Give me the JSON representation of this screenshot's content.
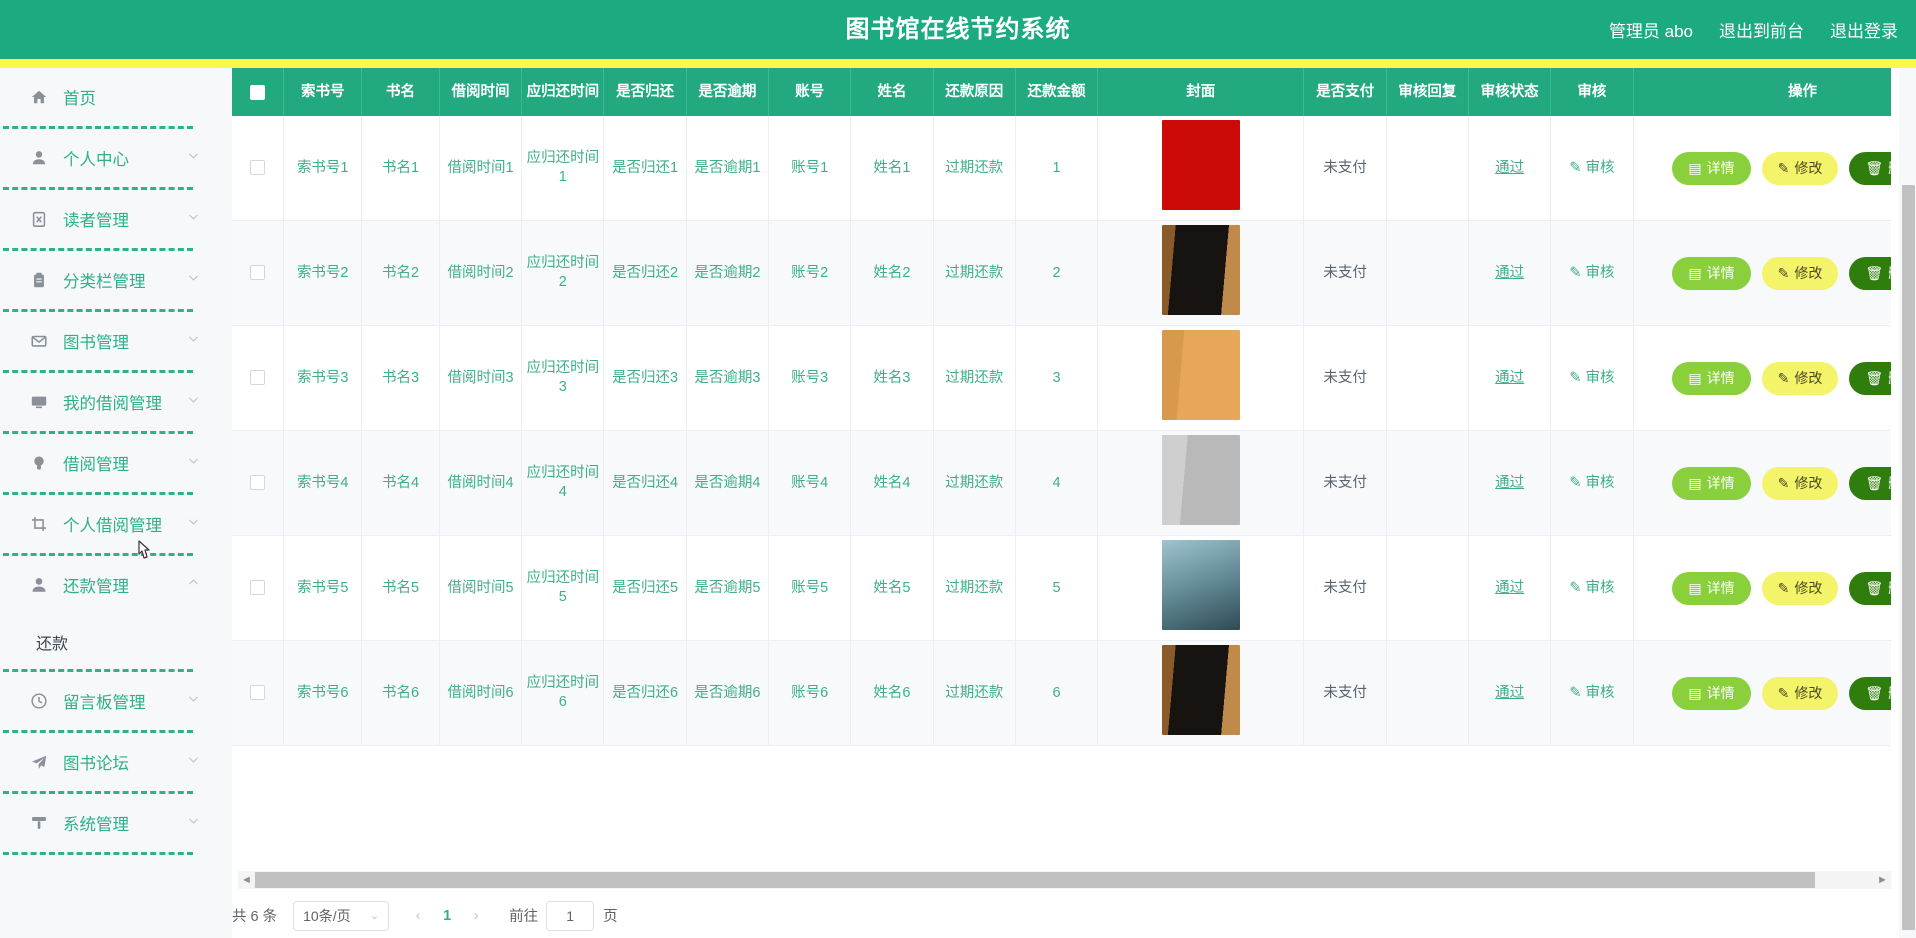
{
  "header": {
    "title": "图书馆在线节约系统",
    "user": "管理员 abo",
    "exit_front": "退出到前台",
    "logout": "退出登录",
    "bg_color": "#1cab81",
    "accent_color": "#faf84b"
  },
  "sidebar": {
    "items": [
      {
        "label": "首页",
        "icon": "home-icon",
        "expandable": false
      },
      {
        "label": "个人中心",
        "icon": "user-icon",
        "expandable": true,
        "expanded": false
      },
      {
        "label": "读者管理",
        "icon": "clipboard-x-icon",
        "expandable": true,
        "expanded": false
      },
      {
        "label": "分类栏管理",
        "icon": "clipboard-icon",
        "expandable": true,
        "expanded": false
      },
      {
        "label": "图书管理",
        "icon": "envelope-icon",
        "expandable": true,
        "expanded": false
      },
      {
        "label": "我的借阅管理",
        "icon": "monitor-icon",
        "expandable": true,
        "expanded": false
      },
      {
        "label": "借阅管理",
        "icon": "bulb-icon",
        "expandable": true,
        "expanded": false
      },
      {
        "label": "个人借阅管理",
        "icon": "crop-icon",
        "expandable": true,
        "expanded": false
      },
      {
        "label": "还款管理",
        "icon": "user-solid-icon",
        "expandable": true,
        "expanded": true
      },
      {
        "label": "留言板管理",
        "icon": "clock-icon",
        "expandable": true,
        "expanded": false
      },
      {
        "label": "图书论坛",
        "icon": "send-icon",
        "expandable": true,
        "expanded": false
      },
      {
        "label": "系统管理",
        "icon": "tool-icon",
        "expandable": true,
        "expanded": false
      }
    ],
    "submenu_of_huankuan": [
      "还款"
    ],
    "label_color": "#2eb088"
  },
  "table": {
    "columns": [
      "",
      "索书号",
      "书名",
      "借阅时间",
      "应归还时间",
      "是否归还",
      "是否逾期",
      "账号",
      "姓名",
      "还款原因",
      "还款金额",
      "封面",
      "是否支付",
      "审核回复",
      "审核状态",
      "审核",
      "操作"
    ],
    "rows": [
      {
        "suoshuhao": "索书号1",
        "shuming": "书名1",
        "jieyue": "借阅时间1",
        "yingguihuan": "应归还时间1",
        "shifouguihuan": "是否归还1",
        "shifouyuqi": "是否逾期1",
        "zhanghao": "账号1",
        "xingming": "姓名1",
        "huankuanyuanyin": "过期还款",
        "huankuanjine": "1",
        "fengmian": "cover-red-monkey",
        "shifouzhifu": "未支付",
        "shenhehuifu": "",
        "shenhezhuangtai": "通过",
        "shenhe": "审核",
        "ops": [
          "详情",
          "修改",
          "删除"
        ]
      },
      {
        "suoshuhao": "索书号2",
        "shuming": "书名2",
        "jieyue": "借阅时间2",
        "yingguihuan": "应归还时间2",
        "shifouguihuan": "是否归还2",
        "shifouyuqi": "是否逾期2",
        "zhanghao": "账号2",
        "xingming": "姓名2",
        "huankuanyuanyin": "过期还款",
        "huankuanjine": "2",
        "fengmian": "cover-black-portrait",
        "shifouzhifu": "未支付",
        "shenhehuifu": "",
        "shenhezhuangtai": "通过",
        "shenhe": "审核",
        "ops": [
          "详情",
          "修改",
          "删除"
        ]
      },
      {
        "suoshuhao": "索书号3",
        "shuming": "书名3",
        "jieyue": "借阅时间3",
        "yingguihuan": "应归还时间3",
        "shifouguihuan": "是否归还3",
        "shifouyuqi": "是否逾期3",
        "zhanghao": "账号3",
        "xingming": "姓名3",
        "huankuanyuanyin": "过期还款",
        "huankuanjine": "3",
        "fengmian": "cover-orange-huainanzi",
        "shifouzhifu": "未支付",
        "shenhehuifu": "",
        "shenhezhuangtai": "通过",
        "shenhe": "审核",
        "ops": [
          "详情",
          "修改",
          "删除"
        ]
      },
      {
        "suoshuhao": "索书号4",
        "shuming": "书名4",
        "jieyue": "借阅时间4",
        "yingguihuan": "应归还时间4",
        "shifouguihuan": "是否归还4",
        "shifouyuqi": "是否逾期4",
        "zhanghao": "账号4",
        "xingming": "姓名4",
        "huankuanyuanyin": "过期还款",
        "huankuanjine": "4",
        "fengmian": "cover-grey-book",
        "shifouzhifu": "未支付",
        "shenhehuifu": "",
        "shenhezhuangtai": "通过",
        "shenhe": "审核",
        "ops": [
          "详情",
          "修改",
          "删除"
        ]
      },
      {
        "suoshuhao": "索书号5",
        "shuming": "书名5",
        "jieyue": "借阅时间5",
        "yingguihuan": "应归还时间5",
        "shifouguihuan": "是否归还5",
        "shifouyuqi": "是否逾期5",
        "zhanghao": "账号5",
        "xingming": "姓名5",
        "huankuanyuanyin": "过期还款",
        "huankuanjine": "5",
        "fengmian": "cover-blue-langyabang",
        "shifouzhifu": "未支付",
        "shenhehuifu": "",
        "shenhezhuangtai": "通过",
        "shenhe": "审核",
        "ops": [
          "详情",
          "修改",
          "删除"
        ]
      },
      {
        "suoshuhao": "索书号6",
        "shuming": "书名6",
        "jieyue": "借阅时间6",
        "yingguihuan": "应归还时间6",
        "shifouguihuan": "是否归还6",
        "shifouyuqi": "是否逾期6",
        "zhanghao": "账号6",
        "xingming": "姓名6",
        "huankuanyuanyin": "过期还款",
        "huankuanjine": "6",
        "fengmian": "cover-black-portrait",
        "shifouzhifu": "未支付",
        "shenhehuifu": "",
        "shenhezhuangtai": "通过",
        "shenhe": "审核",
        "ops": [
          "详情",
          "修改",
          "删除"
        ]
      }
    ]
  },
  "pagination": {
    "total_text": "共 6 条",
    "page_size": "10条/页",
    "prev": "‹",
    "next": "›",
    "current_page": "1",
    "jump_label": "前往",
    "jump_value": "1",
    "jump_unit": "页"
  },
  "buttons": {
    "detail_color": "#8ad03c",
    "edit_color": "#f4f46a",
    "delete_color": "#2f7d0c"
  }
}
